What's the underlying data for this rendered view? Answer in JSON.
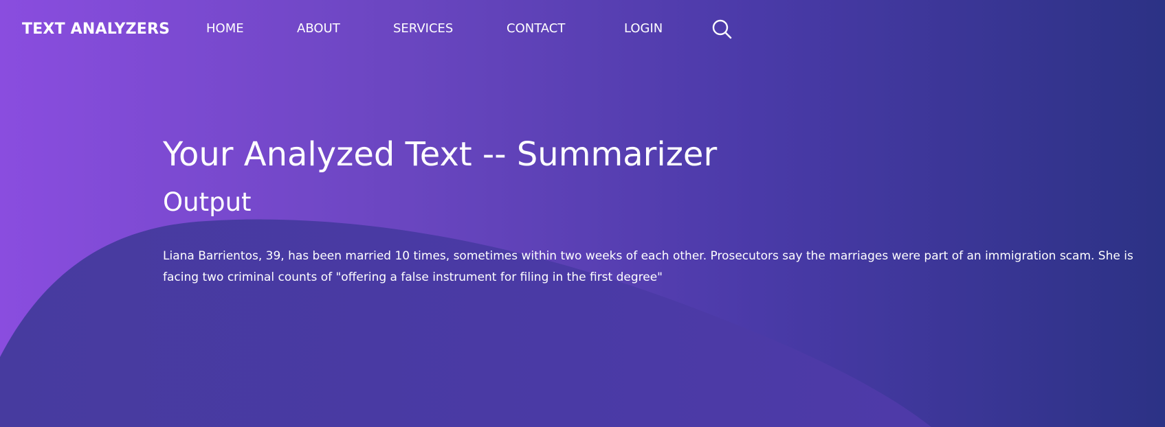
{
  "header": {
    "brand": "TEXT ANALYZERS",
    "nav": [
      {
        "label": "HOME"
      },
      {
        "label": "ABOUT"
      },
      {
        "label": "SERVICES"
      },
      {
        "label": "CONTACT"
      },
      {
        "label": "LOGIN"
      }
    ],
    "search_icon": "search-icon"
  },
  "main": {
    "title": "Your Analyzed Text -- Summarizer",
    "section_title": "Output",
    "output_text": "Liana Barrientos, 39, has been married 10 times, sometimes within two weeks of each other. Prosecutors say the marriages were part of an immigration scam. She is facing two criminal counts of \"offering a false instrument for filing in the first degree\""
  },
  "colors": {
    "gradient_start": "#8a4ddf",
    "gradient_end": "#2c3285",
    "wave": "#46399f",
    "text": "#ffffff"
  }
}
